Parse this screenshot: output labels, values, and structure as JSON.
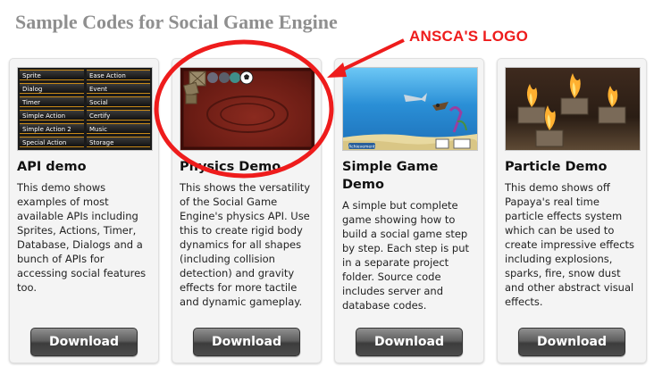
{
  "page": {
    "title": "Sample Codes for Social Game Engine"
  },
  "annotation": {
    "label": "ANSCA'S LOGO",
    "color": "#ee1c1c"
  },
  "cards": [
    {
      "title": "API demo",
      "description": "This demo shows examples of most available APIs including Sprites, Actions, Timer, Database, Dialogs and a bunch of APIs for accessing social features too.",
      "button": "Download",
      "thumb_grid": [
        [
          "Sprite",
          "Ease Action"
        ],
        [
          "Dialog",
          "Event"
        ],
        [
          "Timer",
          "Social"
        ],
        [
          "Simple Action",
          "Certify"
        ],
        [
          "Simple Action 2",
          "Music"
        ],
        [
          "Special Action",
          "Storage"
        ]
      ]
    },
    {
      "title": "Physics Demo",
      "description": "This shows the versatility of the Social Game Engine's physics API. Use this to create rigid body dynamics for all shapes (including collision detection) and gravity effects for more tactile and dynamic gameplay.",
      "button": "Download"
    },
    {
      "title": "Simple Game Demo",
      "description": "A simple but complete game showing how to build a social game step by step. Each step is put in a separate project folder. Source code includes server and database codes.",
      "button": "Download",
      "thumb_badge": "Achievement"
    },
    {
      "title": "Particle Demo",
      "description": "This demo shows off Papaya's real time particle effects system which can be used to create impressive effects including explosions, sparks, fire, snow dust and other abstract visual effects.",
      "button": "Download"
    }
  ]
}
